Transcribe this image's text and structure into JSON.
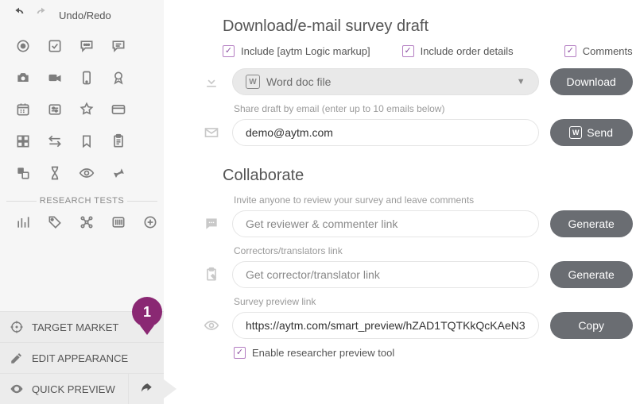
{
  "undo_redo_label": "Undo/Redo",
  "sidebar": {
    "research_tests_label": "RESEARCH TESTS",
    "nav": {
      "target_market": "TARGET MARKET",
      "edit_appearance": "EDIT APPEARANCE",
      "quick_preview": "QUICK PREVIEW"
    }
  },
  "pin_label": "1",
  "download_section": {
    "title": "Download/e-mail survey draft",
    "check_logic": "Include [aytm Logic markup]",
    "check_order": "Include order details",
    "check_comments": "Comments",
    "format_label": "Word doc file",
    "share_hint": "Share draft by email (enter up to 10 emails below)",
    "email_value": "demo@aytm.com",
    "download_btn": "Download",
    "send_btn": "Send"
  },
  "collab_section": {
    "title": "Collaborate",
    "reviewer_hint": "Invite anyone to review your survey and leave comments",
    "reviewer_placeholder": "Get reviewer & commenter link",
    "corrector_hint": "Correctors/translators link",
    "corrector_placeholder": "Get corrector/translator link",
    "preview_hint": "Survey preview link",
    "preview_value": "https://aytm.com/smart_preview/hZAD1TQTKkQcKAeN3",
    "generate_btn": "Generate",
    "copy_btn": "Copy",
    "enable_label": "Enable researcher preview tool"
  }
}
